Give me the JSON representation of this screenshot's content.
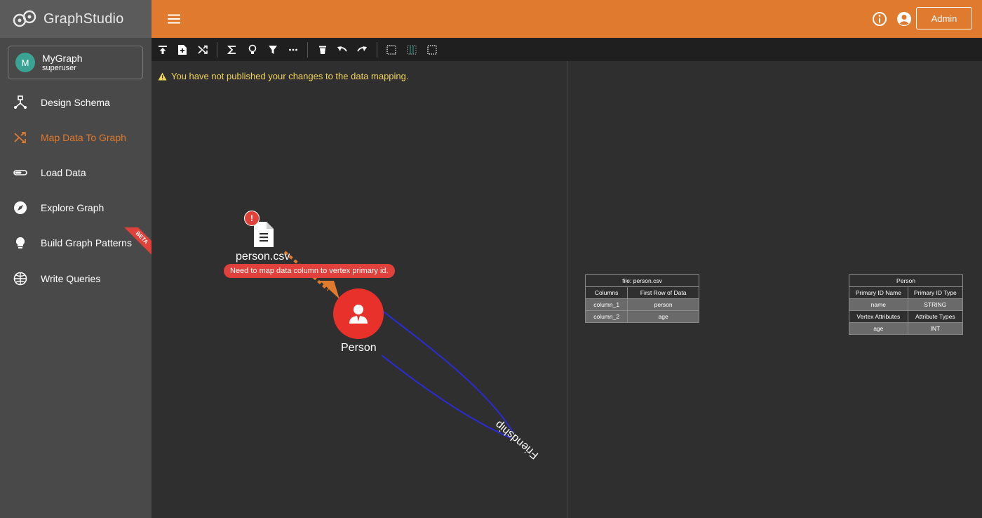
{
  "brand": {
    "name": "GraphStudio"
  },
  "graph": {
    "avatar_letter": "M",
    "name": "MyGraph",
    "user": "superuser"
  },
  "nav": {
    "items": [
      {
        "label": "Design Schema",
        "icon": "schema-icon"
      },
      {
        "label": "Map Data To Graph",
        "icon": "shuffle-icon",
        "active": true
      },
      {
        "label": "Load Data",
        "icon": "load-icon"
      },
      {
        "label": "Explore Graph",
        "icon": "compass-icon"
      },
      {
        "label": "Build Graph Patterns",
        "icon": "lightbulb-icon",
        "badge": "BETA"
      },
      {
        "label": "Write Queries",
        "icon": "globe-icon"
      }
    ]
  },
  "topbar": {
    "user_button": "Admin",
    "icons": [
      "menu-icon",
      "info-icon",
      "account-icon"
    ]
  },
  "colors": {
    "accent": "#e07a2e",
    "sidebar": "#494949",
    "vertex": "#e8312a",
    "edge": "#2b2bd6",
    "warning": "#f1d45a",
    "error": "#e0413a"
  },
  "warning": {
    "text": "You have not published your changes to the data mapping."
  },
  "canvas": {
    "file": {
      "name": "person.csv",
      "error_badge": "!",
      "error_tooltip": "Need to map data column to vertex primary id."
    },
    "vertex": {
      "label": "Person"
    },
    "edge": {
      "label": "Friendship"
    }
  },
  "file_table": {
    "caption": "file: person.csv",
    "headers": [
      "Columns",
      "First Row of Data"
    ],
    "rows": [
      [
        "column_1",
        "person"
      ],
      [
        "column_2",
        "age"
      ]
    ]
  },
  "vertex_table": {
    "caption": "Person",
    "id_headers": [
      "Primary ID Name",
      "Primary ID Type"
    ],
    "id_row": [
      "name",
      "STRING"
    ],
    "attr_headers": [
      "Vertex Attributes",
      "Attribute Types"
    ],
    "attr_rows": [
      [
        "age",
        "INT"
      ]
    ]
  }
}
